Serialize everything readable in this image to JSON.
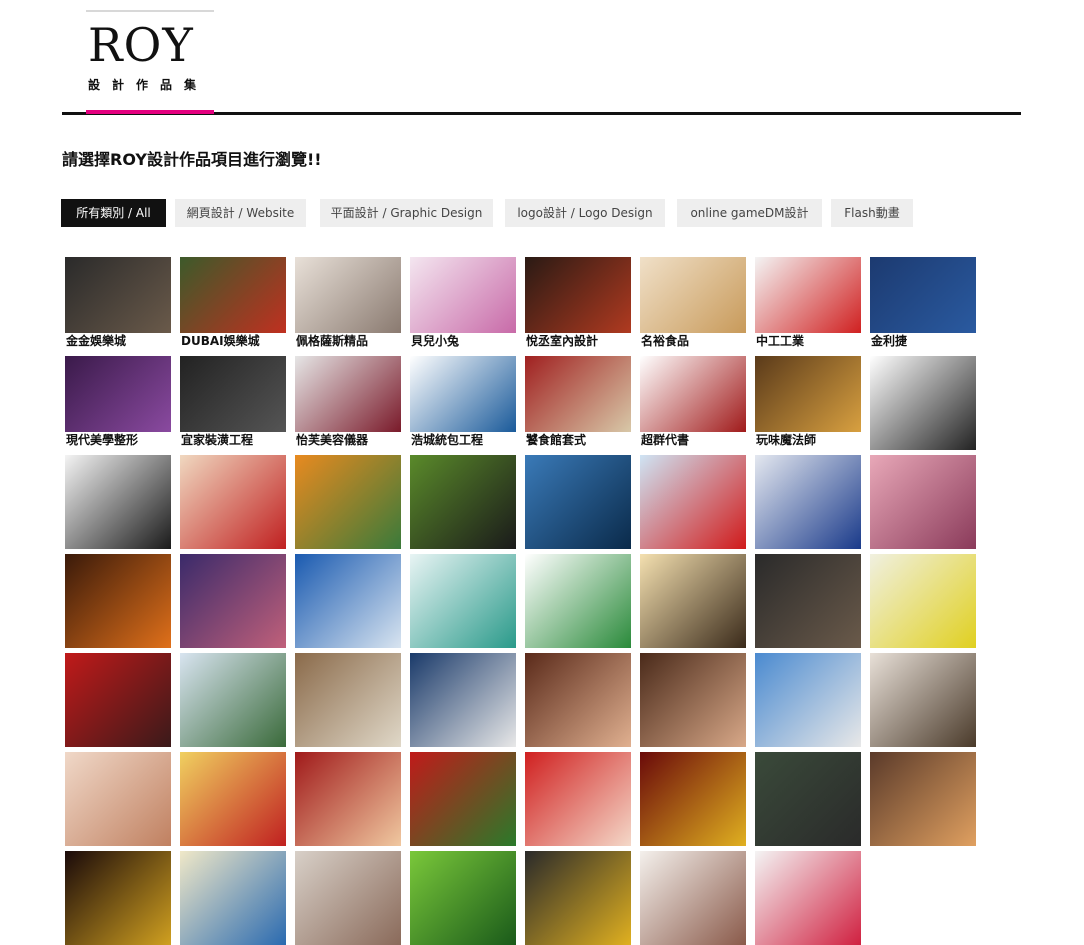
{
  "logo": {
    "title": "ROY",
    "subtitle": "設計作品集",
    "accent": "#e4007f"
  },
  "intro": "請選擇ROY設計作品項目進行瀏覽!!",
  "filters": [
    {
      "label": "所有類別 / All",
      "active": true
    },
    {
      "label": "網頁設計 / Website",
      "active": false
    },
    {
      "label": "平面設計 / Graphic Design",
      "active": false
    },
    {
      "label": "logo設計 / Logo Design",
      "active": false
    },
    {
      "label": "online gameDM設計",
      "active": false
    },
    {
      "label": "Flash動畫",
      "active": false
    }
  ],
  "portfolio": [
    {
      "caption": "金金娛樂城",
      "icon": "diamond-logo-thumbnail",
      "colors": [
        "#2a2a2a",
        "#6a5a4a"
      ]
    },
    {
      "caption": "DUBAI娛樂城",
      "icon": "soccer-promo-thumbnail",
      "colors": [
        "#3c5a2a",
        "#c03020"
      ]
    },
    {
      "caption": "佩格薩斯精品",
      "icon": "pegasus-logo-thumbnail",
      "colors": [
        "#e8e0d8",
        "#8a7a70"
      ]
    },
    {
      "caption": "貝兒小兔",
      "icon": "bunny-brand-thumbnail",
      "colors": [
        "#f4e6f0",
        "#c86aa8"
      ]
    },
    {
      "caption": "悅丞室內設計",
      "icon": "interior-design-thumbnail",
      "colors": [
        "#2a1a14",
        "#b03a20"
      ]
    },
    {
      "caption": "名裕食品",
      "icon": "food-products-thumbnail",
      "colors": [
        "#f0e0c8",
        "#c89a5a"
      ]
    },
    {
      "caption": "中工工業",
      "icon": "industry-logo-thumbnail",
      "colors": [
        "#f4f4f4",
        "#d02020"
      ]
    },
    {
      "caption": "金利捷",
      "icon": "k-logo-thumbnail",
      "colors": [
        "#1c3a70",
        "#2a5aa0"
      ]
    },
    {
      "caption": "現代美學整形",
      "icon": "aesthetic-clinic-thumbnail",
      "colors": [
        "#3a1a4a",
        "#8a4aa0"
      ]
    },
    {
      "caption": "宜家裝潢工程",
      "icon": "renovation-logo-thumbnail",
      "colors": [
        "#222222",
        "#555555"
      ]
    },
    {
      "caption": "怡芙美容儀器",
      "icon": "e-logo-thumbnail",
      "colors": [
        "#e6e6e6",
        "#7a1a2a"
      ]
    },
    {
      "caption": "浩城統包工程",
      "icon": "haocheng-logo-thumbnail",
      "colors": [
        "#ffffff",
        "#1a5a9a"
      ]
    },
    {
      "caption": "饕食館套式",
      "icon": "restaurant-logo-thumbnail",
      "colors": [
        "#a02020",
        "#d8c8a8"
      ]
    },
    {
      "caption": "超群代書",
      "icon": "quill-pen-thumbnail",
      "colors": [
        "#ffffff",
        "#a01a1a"
      ]
    },
    {
      "caption": "玩味魔法師",
      "icon": "fried-food-thumbnail",
      "colors": [
        "#5a3a1a",
        "#d8a040"
      ]
    },
    {
      "caption": "",
      "icon": "cartoon-face-thumbnail",
      "colors": [
        "#ffffff",
        "#222222"
      ]
    },
    {
      "caption": "",
      "icon": "cartoon-face-thumbnail",
      "colors": [
        "#f4f4f4",
        "#1a1a1a"
      ]
    },
    {
      "caption": "",
      "icon": "cartoon-girl-thumbnail",
      "colors": [
        "#f0d8c0",
        "#c02020"
      ]
    },
    {
      "caption": "",
      "icon": "cartoon-guitarist-thumbnail",
      "colors": [
        "#e88a20",
        "#3a7a3a"
      ]
    },
    {
      "caption": "",
      "icon": "bicycle-thumbnail",
      "colors": [
        "#5a8a2a",
        "#1a1a1a"
      ]
    },
    {
      "caption": "",
      "icon": "calligraphy-thumbnail",
      "colors": [
        "#3a7ab8",
        "#0a2a4a"
      ]
    },
    {
      "caption": "",
      "icon": "yahoo-promo-thumbnail",
      "colors": [
        "#cfe4f4",
        "#d01a1a"
      ]
    },
    {
      "caption": "",
      "icon": "machinery-thumbnail",
      "colors": [
        "#e4e8f0",
        "#1a3a8a"
      ]
    },
    {
      "caption": "",
      "icon": "spa-portrait-thumbnail",
      "colors": [
        "#e8a8b8",
        "#8a3a5a"
      ]
    },
    {
      "caption": "",
      "icon": "trumpet-thumbnail",
      "colors": [
        "#3a1a0a",
        "#e0701a"
      ]
    },
    {
      "caption": "",
      "icon": "dancers-thumbnail",
      "colors": [
        "#3a2a6a",
        "#c0607a"
      ]
    },
    {
      "caption": "",
      "icon": "soldering-thumbnail",
      "colors": [
        "#1a5ab0",
        "#d8e4f0"
      ]
    },
    {
      "caption": "",
      "icon": "swirl-logo-thumbnail",
      "colors": [
        "#e8f4f4",
        "#2a9a8a"
      ]
    },
    {
      "caption": "",
      "icon": "bicycle-shop-thumbnail",
      "colors": [
        "#ffffff",
        "#2a8a3a"
      ]
    },
    {
      "caption": "",
      "icon": "cartoon-man-thumbnail",
      "colors": [
        "#f4e0b0",
        "#3a2a1a"
      ]
    },
    {
      "caption": "",
      "icon": "diamond-logo-thumbnail",
      "colors": [
        "#2a2a2a",
        "#6a5a4a"
      ]
    },
    {
      "caption": "",
      "icon": "lottery-balls-thumbnail",
      "colors": [
        "#f0f0e0",
        "#e0d020"
      ]
    },
    {
      "caption": "",
      "icon": "soccer-player-thumbnail",
      "colors": [
        "#c01a1a",
        "#3a1a1a"
      ]
    },
    {
      "caption": "",
      "icon": "soccer-promo-thumbnail",
      "colors": [
        "#d8e4f0",
        "#3a6a3a"
      ]
    },
    {
      "caption": "",
      "icon": "baseball-thumbnail",
      "colors": [
        "#8a6a4a",
        "#e0d8c8"
      ]
    },
    {
      "caption": "",
      "icon": "playing-cards-thumbnail",
      "colors": [
        "#1a3a6a",
        "#e8e8e8"
      ]
    },
    {
      "caption": "",
      "icon": "portrait-thumbnail",
      "colors": [
        "#5a2a1a",
        "#e0b090"
      ]
    },
    {
      "caption": "",
      "icon": "portrait-thumbnail",
      "colors": [
        "#4a2a1a",
        "#d8a888"
      ]
    },
    {
      "caption": "",
      "icon": "soccer-kick-thumbnail",
      "colors": [
        "#4a8ad0",
        "#e8e8e8"
      ]
    },
    {
      "caption": "",
      "icon": "portrait-thumbnail",
      "colors": [
        "#e8e0d8",
        "#4a3a2a"
      ]
    },
    {
      "caption": "",
      "icon": "children-thumbnail",
      "colors": [
        "#f0d8c8",
        "#c08060"
      ]
    },
    {
      "caption": "",
      "icon": "promo-51-thumbnail",
      "colors": [
        "#f0d060",
        "#c02020"
      ]
    },
    {
      "caption": "",
      "icon": "portrait-thumbnail",
      "colors": [
        "#a01a1a",
        "#f0c8a0"
      ]
    },
    {
      "caption": "",
      "icon": "santa-thumbnail",
      "colors": [
        "#c01a1a",
        "#2a7a2a"
      ]
    },
    {
      "caption": "",
      "icon": "christmas-portrait-thumbnail",
      "colors": [
        "#d02020",
        "#f4d8c8"
      ]
    },
    {
      "caption": "",
      "icon": "lottery-promo-thumbnail",
      "colors": [
        "#6a0a0a",
        "#e0b020"
      ]
    },
    {
      "caption": "",
      "icon": "speaker-thumbnail",
      "colors": [
        "#3a4a3a",
        "#2a2a2a"
      ]
    },
    {
      "caption": "",
      "icon": "game-character-thumbnail",
      "colors": [
        "#5a3a2a",
        "#e0a060"
      ]
    },
    {
      "caption": "",
      "icon": "dragon-thumbnail",
      "colors": [
        "#1a0a0a",
        "#d0a020"
      ]
    },
    {
      "caption": "",
      "icon": "coins-thumbnail",
      "colors": [
        "#f0e8c8",
        "#2a6ab0"
      ]
    },
    {
      "caption": "",
      "icon": "smartphone-thumbnail",
      "colors": [
        "#d8d0c8",
        "#8a6a5a"
      ]
    },
    {
      "caption": "",
      "icon": "cartoon-boy-thumbnail",
      "colors": [
        "#7ac83a",
        "#1a5a1a"
      ]
    },
    {
      "caption": "",
      "icon": "gold-bars-thumbnail",
      "colors": [
        "#2a2a2a",
        "#e0b020"
      ]
    },
    {
      "caption": "",
      "icon": "portrait-thumbnail",
      "colors": [
        "#f4f0ec",
        "#8a5a4a"
      ]
    },
    {
      "caption": "",
      "icon": "bingo-balls-thumbnail",
      "colors": [
        "#f4f4f4",
        "#d02040"
      ]
    }
  ]
}
